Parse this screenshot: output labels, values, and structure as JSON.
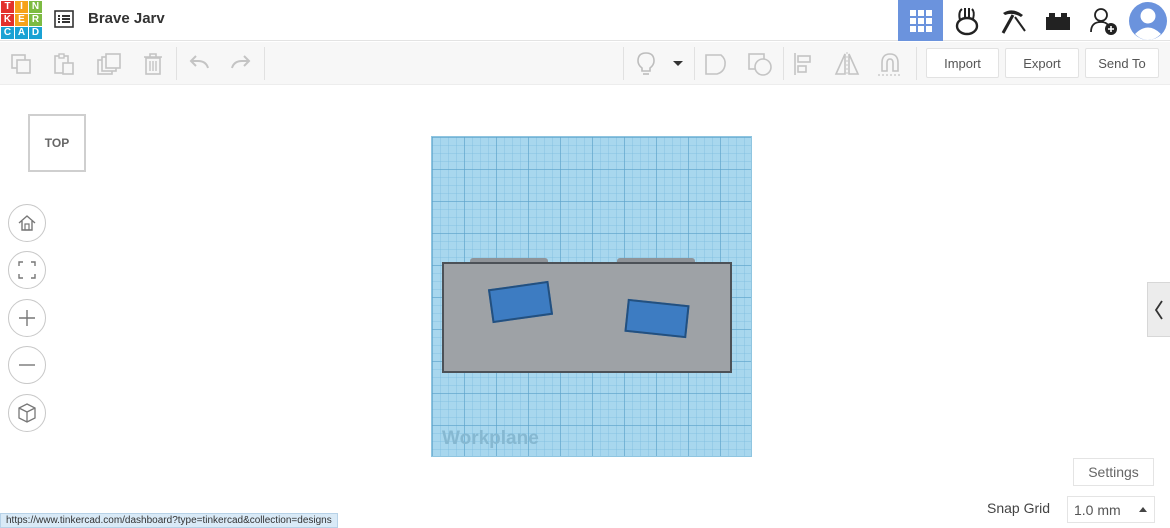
{
  "app": {
    "logo_letters": [
      "T",
      "I",
      "N",
      "K",
      "E",
      "R",
      "C",
      "A",
      "D"
    ],
    "logo_colors": [
      "#e3312b",
      "#f6a21a",
      "#7dbb42",
      "#e3312b",
      "#f6a21a",
      "#7dbb42",
      "#1aa2d4",
      "#1aa2d4",
      "#1aa2d4"
    ],
    "design_title": "Brave Jarv"
  },
  "header_nav": [
    {
      "name": "3d-design-icon",
      "active": true
    },
    {
      "name": "circuits-icon",
      "active": false
    },
    {
      "name": "minecraft-pickaxe-icon",
      "active": false
    },
    {
      "name": "lego-brick-icon",
      "active": false
    },
    {
      "name": "add-user-icon",
      "active": false
    },
    {
      "name": "avatar",
      "active": false
    }
  ],
  "toolbar": {
    "import_label": "Import",
    "export_label": "Export",
    "send_to_label": "Send To"
  },
  "viewport": {
    "view_cube_label": "TOP",
    "workplane_label": "Workplane",
    "settings_label": "Settings",
    "snap_grid_label": "Snap Grid",
    "snap_grid_value": "1.0 mm"
  },
  "status_bar": {
    "url": "https://www.tinkercad.com/dashboard?type=tinkercad&collection=designs"
  },
  "colors": {
    "accent_active": "#6b93dd",
    "workplane": "#a8d7ee",
    "shape_gray": "#9ea2a6",
    "shape_blue": "#3d7cc2"
  }
}
